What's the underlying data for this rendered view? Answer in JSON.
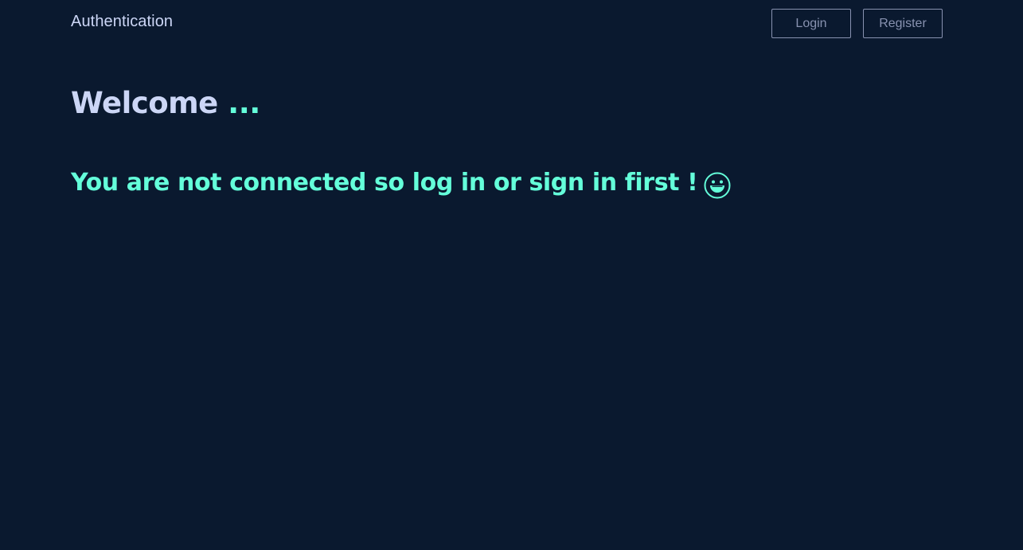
{
  "header": {
    "brand": "Authentication",
    "login_label": "Login",
    "register_label": "Register"
  },
  "main": {
    "welcome_text": "Welcome",
    "welcome_dots": " ...",
    "message": "You are not connected so log in or sign in first !",
    "emoji_icon": "grinning-face-icon"
  },
  "colors": {
    "background": "#0a192f",
    "primary_text": "#ccd6f6",
    "accent": "#64ffda",
    "muted": "#8892b0"
  }
}
